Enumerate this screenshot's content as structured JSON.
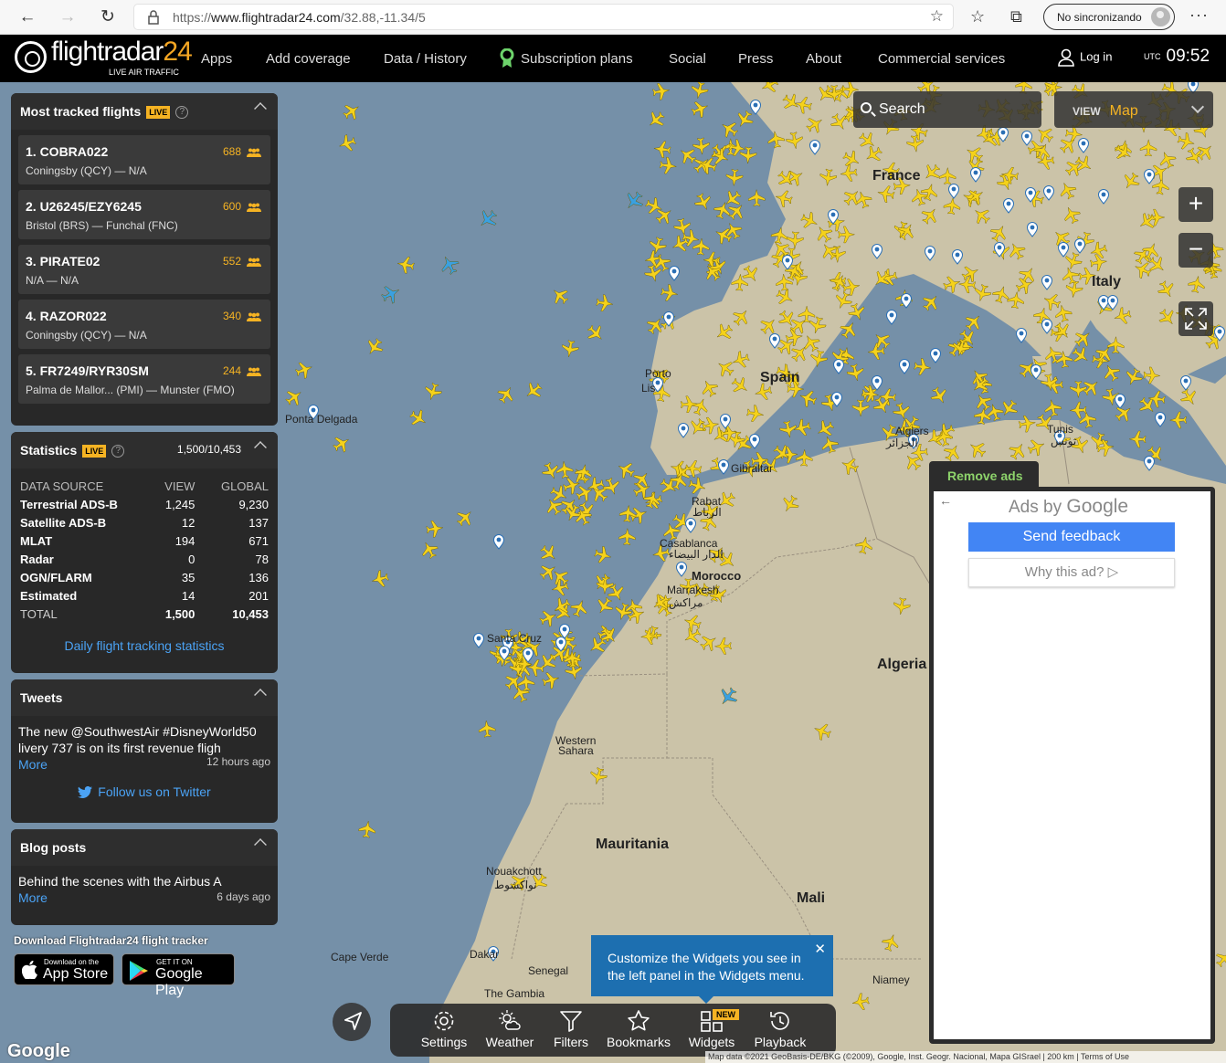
{
  "browser": {
    "url_prefix": "https://",
    "url_host": "www.flightradar24.com",
    "url_path": "/32.88,-11.34/5",
    "sync_label": "No sincronizando"
  },
  "nav": {
    "logo_text": "flightradar",
    "logo_num": "24",
    "logo_tag": "LIVE AIR TRAFFIC",
    "items": [
      "Apps",
      "Add coverage",
      "Data / History",
      "Subscription plans",
      "Social",
      "Press",
      "About",
      "Commercial services"
    ],
    "login": "Log in",
    "utc_label": "UTC",
    "time": "09:52"
  },
  "most_tracked": {
    "title": "Most tracked flights",
    "live": "LIVE",
    "flights": [
      {
        "callsign": "1. COBRA022",
        "route": "Coningsby (QCY) — N/A",
        "count": "688"
      },
      {
        "callsign": "2. U26245/EZY6245",
        "route": "Bristol (BRS) — Funchal (FNC)",
        "count": "600"
      },
      {
        "callsign": "3. PIRATE02",
        "route": "N/A — N/A",
        "count": "552"
      },
      {
        "callsign": "4. RAZOR022",
        "route": "Coningsby (QCY) — N/A",
        "count": "340"
      },
      {
        "callsign": "5. FR7249/RYR30SM",
        "route": "Palma de Mallor... (PMI) — Munster (FMO)",
        "count": "244"
      }
    ]
  },
  "statistics": {
    "title": "Statistics",
    "live": "LIVE",
    "summary": "1,500/10,453",
    "headers": [
      "DATA SOURCE",
      "VIEW",
      "GLOBAL"
    ],
    "rows": [
      {
        "source": "Terrestrial ADS-B",
        "view": "1,245",
        "global": "9,230"
      },
      {
        "source": "Satellite ADS-B",
        "view": "12",
        "global": "137"
      },
      {
        "source": "MLAT",
        "view": "194",
        "global": "671"
      },
      {
        "source": "Radar",
        "view": "0",
        "global": "78"
      },
      {
        "source": "OGN/FLARM",
        "view": "35",
        "global": "136"
      },
      {
        "source": "Estimated",
        "view": "14",
        "global": "201"
      }
    ],
    "total": {
      "source": "TOTAL",
      "view": "1,500",
      "global": "10,453"
    },
    "link": "Daily flight tracking statistics"
  },
  "tweets": {
    "title": "Tweets",
    "text_line1": "The new @SouthwestAir #DisneyWorld50",
    "text_line2": "livery 737 is on its first revenue fligh",
    "more": "More",
    "ago": "12 hours ago",
    "follow": "Follow us on Twitter"
  },
  "blog": {
    "title": "Blog posts",
    "text": "Behind the scenes with the Airbus A",
    "more": "More",
    "ago": "6 days ago"
  },
  "download": {
    "label": "Download Flightradar24 flight tracker",
    "appstore_small": "Download on the",
    "appstore_big": "App Store",
    "play_small": "GET IT ON",
    "play_big": "Google Play"
  },
  "map_controls": {
    "search": "Search",
    "view_label": "VIEW",
    "view_value": "Map"
  },
  "map_labels": [
    {
      "text": "Spain",
      "cls": "big"
    },
    {
      "text": "Morocco",
      "cls": "big"
    },
    {
      "text": "Algeria",
      "cls": "big"
    },
    {
      "text": "Mauritania",
      "cls": "big"
    },
    {
      "text": "Mali",
      "cls": "big"
    },
    {
      "text": "Western",
      "cls": ""
    },
    {
      "text": "Sahara",
      "cls": ""
    },
    {
      "text": "Cape Verde",
      "cls": ""
    },
    {
      "text": "Nouakchott",
      "cls": ""
    },
    {
      "text": "نواكشوط",
      "cls": ""
    },
    {
      "text": "Senegal",
      "cls": ""
    },
    {
      "text": "The Gambia",
      "cls": ""
    },
    {
      "text": "Casablanca",
      "cls": ""
    },
    {
      "text": "الدار البيضاء",
      "cls": ""
    },
    {
      "text": "Marrakesh",
      "cls": ""
    },
    {
      "text": "مراكش",
      "cls": ""
    },
    {
      "text": "Rabat",
      "cls": ""
    },
    {
      "text": "الرباط",
      "cls": ""
    },
    {
      "text": "Algiers",
      "cls": ""
    },
    {
      "text": "الجزائر",
      "cls": ""
    },
    {
      "text": "Tunis",
      "cls": ""
    },
    {
      "text": "تونس",
      "cls": ""
    },
    {
      "text": "Santa Cruz",
      "cls": ""
    },
    {
      "text": "Porto",
      "cls": ""
    },
    {
      "text": "Lis",
      "cls": ""
    },
    {
      "text": "France",
      "cls": "big"
    },
    {
      "text": "Italy",
      "cls": "big"
    },
    {
      "text": "Niamey",
      "cls": ""
    },
    {
      "text": "Dakar",
      "cls": ""
    },
    {
      "text": "Ponta Delgada",
      "cls": ""
    },
    {
      "text": "Gibraltar",
      "cls": ""
    }
  ],
  "ad": {
    "remove": "Remove ads",
    "ads_by": "Ads by",
    "google": "Google",
    "feedback": "Send feedback",
    "why": "Why this ad? ▷"
  },
  "toolbar": {
    "items": [
      "Settings",
      "Weather",
      "Filters",
      "Bookmarks",
      "Widgets",
      "Playback"
    ],
    "new_badge": "NEW"
  },
  "tip": {
    "line1": "Customize the Widgets you see in",
    "line2": "the left panel in the Widgets menu.",
    "close": "✕"
  },
  "attribution": "Map data ©2021 GeoBasis-DE/BKG (©2009), Google, Inst. Geogr. Nacional, Mapa GISrael | 200 km | Terms of Use",
  "google_logo": "Google",
  "colors": {
    "plane": "#f5d21b",
    "plane_tracked": "#3aa0e0",
    "accent": "#f5b323",
    "land": "#c8bfa4",
    "sea": "#7590a8"
  }
}
